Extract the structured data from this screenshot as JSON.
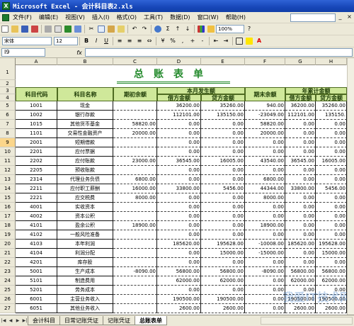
{
  "window": {
    "title": "Microsoft Excel - 会计科目表2.xls",
    "app_icon": "X"
  },
  "menu": {
    "items": [
      "文件(F)",
      "编辑(E)",
      "视图(V)",
      "插入(I)",
      "格式(O)",
      "工具(T)",
      "数据(D)",
      "窗口(W)",
      "帮助(H)"
    ],
    "close_icon": "×",
    "min_icon": "_"
  },
  "toolbar": {
    "zoom": "100%",
    "font_name": "宋体",
    "font_size": "12",
    "bold_label": "B",
    "italic_label": "I",
    "underline_label": "U"
  },
  "formula_bar": {
    "name_box": "I9",
    "fx_label": "fx",
    "formula": ""
  },
  "columns": [
    "A",
    "B",
    "C",
    "D",
    "E",
    "F",
    "G",
    "H"
  ],
  "rows": [
    1,
    2,
    3,
    4,
    5,
    6,
    7,
    8,
    9,
    10,
    11,
    12,
    13,
    14,
    15,
    16,
    17,
    18,
    19,
    20,
    21,
    22,
    23,
    24,
    25,
    26,
    27
  ],
  "selected_row": 9,
  "sheet": {
    "title": "总账表单",
    "headers": {
      "code": "科目代码",
      "name": "科目名称",
      "opening": "期初余额",
      "period_group": "本月发生额",
      "debit": "借方金额",
      "credit": "贷方金额",
      "closing": "期末余额",
      "ytd_group": "年累计金额",
      "ytd_debit": "借方金额",
      "ytd_credit": "贷方金额"
    },
    "data": [
      [
        "1001",
        "现金",
        "",
        "36200.00",
        "35260.00",
        "940.00",
        "36200.00",
        "35260.00"
      ],
      [
        "1002",
        "银行存款",
        "",
        "112101.00",
        "135150.00",
        "-23049.00",
        "112101.00",
        "135150."
      ],
      [
        "1015",
        "其他货币基金",
        "58820.00",
        "0.00",
        "0.00",
        "58820.00",
        "0.00",
        "0.00"
      ],
      [
        "1101",
        "交易性金融资产",
        "20000.00",
        "0.00",
        "0.00",
        "20000.00",
        "0.00",
        "0.00"
      ],
      [
        "2001",
        "短期借款",
        "",
        "0.00",
        "0.00",
        "0.00",
        "0.00",
        "0.00"
      ],
      [
        "2201",
        "应付票据",
        "",
        "0.00",
        "0.00",
        "0.00",
        "0.00",
        "0.00"
      ],
      [
        "2202",
        "应付账款",
        "23000.00",
        "36545.00",
        "16005.00",
        "43540.00",
        "36545.00",
        "16005.00"
      ],
      [
        "2205",
        "预收账款",
        "",
        "0.00",
        "0.00",
        "0.00",
        "0.00",
        "0.00"
      ],
      [
        "2314",
        "代理业务负债",
        "6800.00",
        "0.00",
        "0.00",
        "6800.00",
        "0.00",
        "0.00"
      ],
      [
        "2211",
        "应付职工薪酬",
        "16000.00",
        "33800.00",
        "5456.00",
        "44344.00",
        "33800.00",
        "5456.00"
      ],
      [
        "2221",
        "应交税费",
        "8000.00",
        "0.00",
        "0.00",
        "8000.00",
        "0.00",
        "0.00"
      ],
      [
        "4001",
        "实收资本",
        "",
        "0.00",
        "0.00",
        "0.00",
        "0.00",
        "0.00"
      ],
      [
        "4002",
        "资本公积",
        "",
        "0.00",
        "0.00",
        "0.00",
        "0.00",
        "0.00"
      ],
      [
        "4101",
        "盈余公积",
        "18900.00",
        "0.00",
        "0.00",
        "18900.00",
        "0.00",
        "0.00"
      ],
      [
        "4102",
        "一般风险准备",
        "",
        "0.00",
        "0.00",
        "0.00",
        "0.00",
        "0.00"
      ],
      [
        "4103",
        "本年利润",
        "",
        "185620.00",
        "195628.00",
        "-10008.00",
        "185620.00",
        "195628.00"
      ],
      [
        "4104",
        "利润分配",
        "",
        "0.00",
        "15000.00",
        "-15000.00",
        "0.00",
        "15000.00"
      ],
      [
        "4201",
        "库存股",
        "",
        "0.00",
        "0.00",
        "0.00",
        "0.00",
        "0.00"
      ],
      [
        "5001",
        "生产成本",
        "-8090.00",
        "56800.00",
        "56800.00",
        "-8090.00",
        "56800.00",
        "56800.00"
      ],
      [
        "5101",
        "制造费用",
        "",
        "62000.00",
        "62000.00",
        "0.00",
        "62000.00",
        "62000.00"
      ],
      [
        "5201",
        "劳务成本",
        "",
        "0.00",
        "0.00",
        "0.00",
        "0.00",
        "0.00"
      ],
      [
        "6001",
        "主营业务收入",
        "",
        "190500.00",
        "190500.00",
        "0.00",
        "190500.00",
        "190500.00"
      ],
      [
        "6051",
        "其他业务收入",
        "",
        "2600.00",
        "2600.00",
        "0.00",
        "2600.00",
        "2600.00"
      ]
    ]
  },
  "tabs": [
    "会计科目",
    "日常记账凭证",
    "记账凭证",
    "总账表单"
  ],
  "active_tab": 3,
  "watermark": "我爱IT技术网",
  "colors": {
    "title_green": "#238a2c",
    "header_fill": "#cfe89a",
    "titlebar_blue": "#1746b8"
  }
}
